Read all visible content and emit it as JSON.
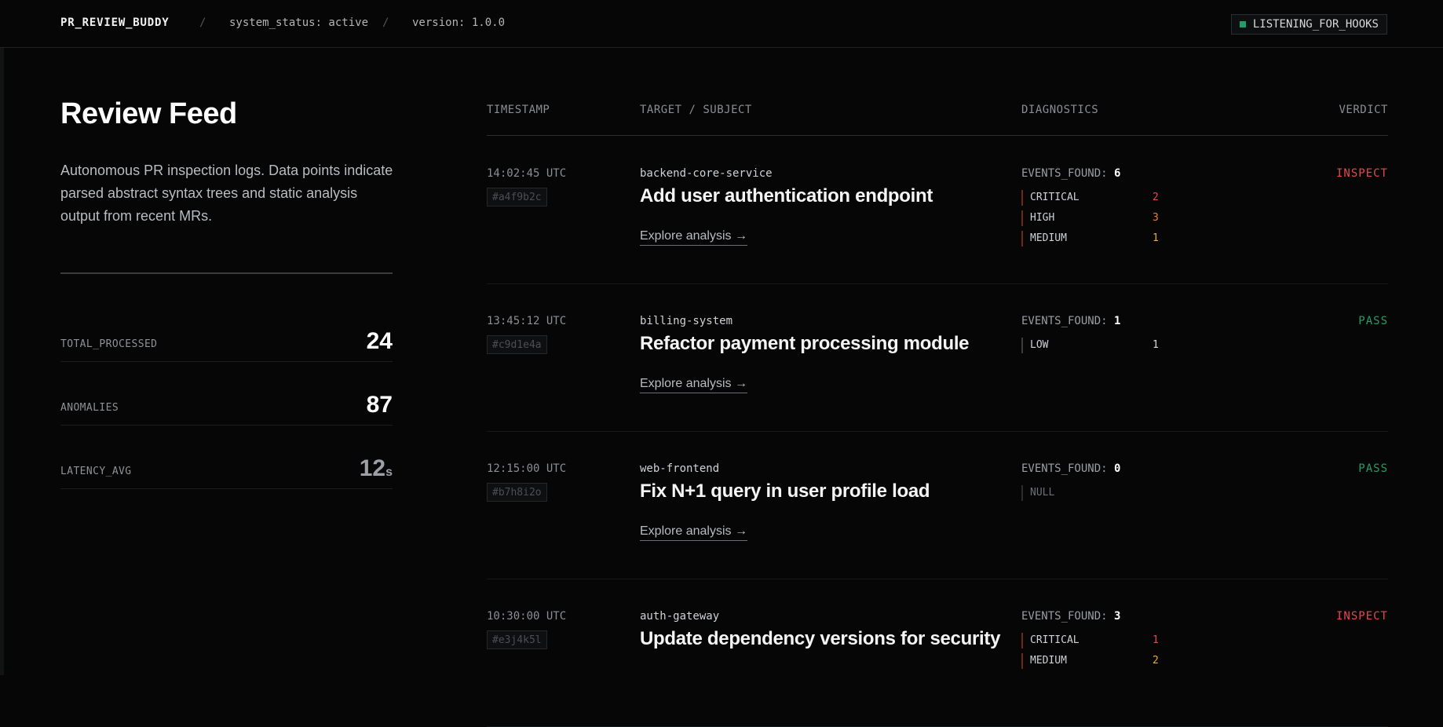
{
  "header": {
    "brand": "PR_REVIEW_BUDDY",
    "separator": "/",
    "system_status": "system_status: active",
    "version": "version: 1.0.0",
    "hook_badge": "LISTENING_FOR_HOOKS"
  },
  "sidebar": {
    "title": "Review Feed",
    "description": "Autonomous PR inspection logs. Data points indicate parsed abstract syntax trees and static analysis output from recent MRs.",
    "stats": [
      {
        "label": "TOTAL_PROCESSED",
        "value": "24"
      },
      {
        "label": "ANOMALIES",
        "value": "87"
      },
      {
        "label": "LATENCY_AVG",
        "value": "12",
        "unit": "s"
      }
    ]
  },
  "feed": {
    "columns": {
      "timestamp": "TIMESTAMP",
      "target": "TARGET / SUBJECT",
      "diagnostics": "DIAGNOSTICS",
      "verdict": "VERDICT"
    },
    "explore_label": "Explore analysis →",
    "events_label": "EVENTS_FOUND:",
    "rows": [
      {
        "timestamp": "14:02:45 UTC",
        "hash": "#a4f9b2c",
        "target": "backend-core-service",
        "subject": "Add user authentication endpoint",
        "events_found": "6",
        "diagnostics": [
          {
            "level": "CRITICAL",
            "count": "2"
          },
          {
            "level": "HIGH",
            "count": "3"
          },
          {
            "level": "MEDIUM",
            "count": "1"
          }
        ],
        "verdict": "INSPECT"
      },
      {
        "timestamp": "13:45:12 UTC",
        "hash": "#c9d1e4a",
        "target": "billing-system",
        "subject": "Refactor payment processing module",
        "events_found": "1",
        "diagnostics": [
          {
            "level": "LOW",
            "count": "1"
          }
        ],
        "verdict": "PASS"
      },
      {
        "timestamp": "12:15:00 UTC",
        "hash": "#b7h8i2o",
        "target": "web-frontend",
        "subject": "Fix N+1 query in user profile load",
        "events_found": "0",
        "diagnostics": [
          {
            "level": "NULL",
            "count": ""
          }
        ],
        "verdict": "PASS"
      },
      {
        "timestamp": "10:30:00 UTC",
        "hash": "#e3j4k5l",
        "target": "auth-gateway",
        "subject": "Update dependency versions for security",
        "events_found": "3",
        "diagnostics": [
          {
            "level": "CRITICAL",
            "count": "1"
          },
          {
            "level": "MEDIUM",
            "count": "2"
          }
        ],
        "verdict": "INSPECT"
      }
    ]
  },
  "colors": {
    "critical": "#e5484d",
    "high": "#ef7a34",
    "medium": "#e8a93a",
    "low": "#d9d9d9",
    "inspect": "#e5484d",
    "pass": "#1e9e6a",
    "listening_dot": "#1e9e6a"
  }
}
